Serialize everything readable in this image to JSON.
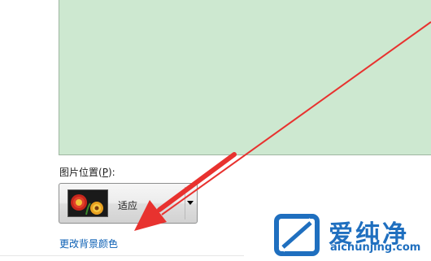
{
  "picture_position": {
    "label_prefix": "图片位置(",
    "label_mnemonic": "P",
    "label_suffix": "):",
    "selected_value": "适应"
  },
  "change_background_link": "更改背景颜色",
  "watermark": {
    "title": "爱纯净",
    "domain": "aichunjing.com"
  },
  "colors": {
    "preview_background": "#cde8d0",
    "link": "#0b5fb4",
    "arrow": "#e8322f",
    "watermark": "#1f6fbf"
  }
}
